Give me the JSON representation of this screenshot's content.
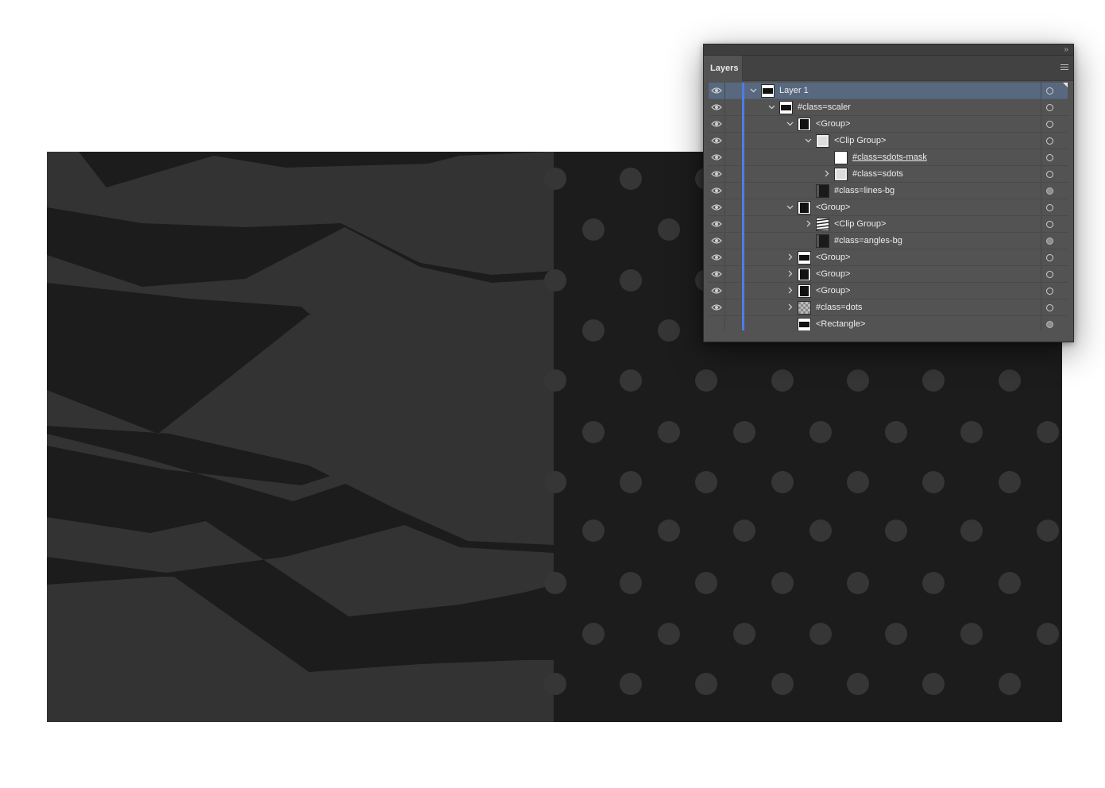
{
  "panel": {
    "tab_label": "Layers",
    "collapse_glyph": "››",
    "menu_icon": "hamburger-menu-icon"
  },
  "colors": {
    "artboard_dark": "#1c1c1c",
    "stripe_grey": "#333333",
    "dot_grey": "#363636",
    "layer_color_bar": "#4f7ce8",
    "selected_row": "#58697f"
  },
  "layers": [
    {
      "name": "Layer 1",
      "depth": 0,
      "chevron": "down",
      "thumb": "rect-white-bar",
      "visible": true,
      "selected": true,
      "target_filled": false,
      "underline": false
    },
    {
      "name": "#class=scaler",
      "depth": 1,
      "chevron": "down",
      "thumb": "rect-white-bar",
      "visible": true,
      "selected": false,
      "target_filled": false,
      "underline": false
    },
    {
      "name": "<Group>",
      "depth": 2,
      "chevron": "down",
      "thumb": "black-box",
      "visible": true,
      "selected": false,
      "target_filled": false,
      "underline": false
    },
    {
      "name": "<Clip Group>",
      "depth": 3,
      "chevron": "down",
      "thumb": "light-grid",
      "visible": true,
      "selected": false,
      "target_filled": false,
      "underline": false
    },
    {
      "name": "#class=sdots-mask",
      "depth": 4,
      "chevron": "none",
      "thumb": "white",
      "visible": true,
      "selected": false,
      "target_filled": false,
      "underline": true
    },
    {
      "name": "#class=sdots",
      "depth": 4,
      "chevron": "right",
      "thumb": "light-grid",
      "visible": true,
      "selected": false,
      "target_filled": false,
      "underline": false
    },
    {
      "name": "#class=lines-bg",
      "depth": 3,
      "chevron": "none",
      "thumb": "black-fill",
      "visible": true,
      "selected": false,
      "target_filled": true,
      "underline": false
    },
    {
      "name": "<Group>",
      "depth": 2,
      "chevron": "down",
      "thumb": "black-box",
      "visible": true,
      "selected": false,
      "target_filled": false,
      "underline": false
    },
    {
      "name": "<Clip Group>",
      "depth": 3,
      "chevron": "right",
      "thumb": "stripes",
      "visible": true,
      "selected": false,
      "target_filled": false,
      "underline": false
    },
    {
      "name": "#class=angles-bg",
      "depth": 3,
      "chevron": "none",
      "thumb": "black-fill",
      "visible": true,
      "selected": false,
      "target_filled": true,
      "underline": false
    },
    {
      "name": "<Group>",
      "depth": 2,
      "chevron": "right",
      "thumb": "rect-white-bar",
      "visible": true,
      "selected": false,
      "target_filled": false,
      "underline": false
    },
    {
      "name": "<Group>",
      "depth": 2,
      "chevron": "right",
      "thumb": "black-box",
      "visible": true,
      "selected": false,
      "target_filled": false,
      "underline": false
    },
    {
      "name": "<Group>",
      "depth": 2,
      "chevron": "right",
      "thumb": "black-box",
      "visible": true,
      "selected": false,
      "target_filled": false,
      "underline": false
    },
    {
      "name": "#class=dots",
      "depth": 2,
      "chevron": "right",
      "thumb": "checker",
      "visible": true,
      "selected": false,
      "target_filled": false,
      "underline": false
    },
    {
      "name": "<Rectangle>",
      "depth": 2,
      "chevron": "none",
      "thumb": "rect-white-bar",
      "visible": false,
      "selected": false,
      "target_filled": true,
      "underline": false
    }
  ]
}
